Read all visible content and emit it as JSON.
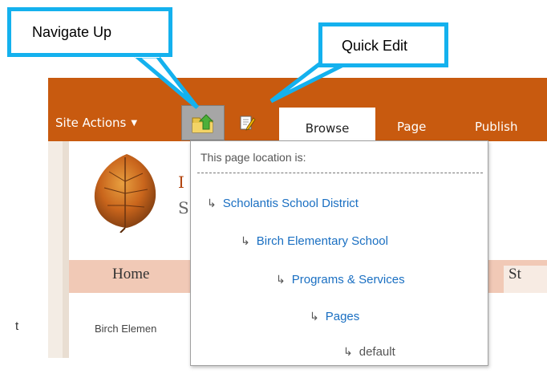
{
  "callouts": {
    "navigate_up": "Navigate Up",
    "quick_edit": "Quick Edit"
  },
  "ribbon": {
    "site_actions": "Site Actions",
    "tabs": [
      "Browse",
      "Page",
      "Publish"
    ]
  },
  "site": {
    "title_partial": "I",
    "subtitle_partial": "S"
  },
  "topnav": {
    "home": "Home",
    "partial_item": "St"
  },
  "breadcrumb_partial": "Birch Elemen",
  "stray_text": "t",
  "dropdown": {
    "header": "This page location is:",
    "items": [
      {
        "label": "Scholantis School District",
        "current": false
      },
      {
        "label": "Birch Elementary School",
        "current": false
      },
      {
        "label": "Programs & Services",
        "current": false
      },
      {
        "label": "Pages",
        "current": false
      },
      {
        "label": "default",
        "current": true
      }
    ]
  },
  "icons": {
    "navigate_up": "folder-up-arrow-icon",
    "quick_edit": "pencil-page-icon",
    "logo": "autumn-leaf-logo"
  },
  "colors": {
    "ribbon": "#c85a0f",
    "callout_border": "#14b1ee",
    "link": "#1a6fc2",
    "topnav": "#f1c9b6"
  }
}
